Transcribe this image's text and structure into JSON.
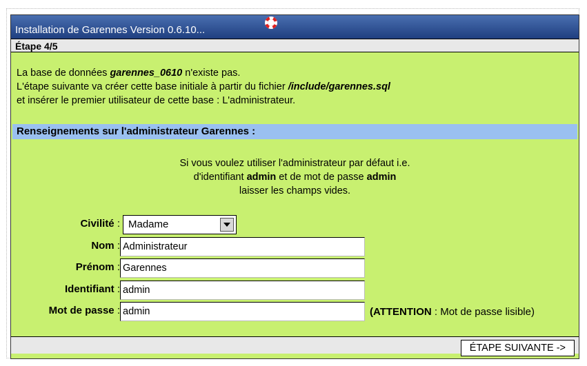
{
  "window": {
    "title": "Installation de Garennes Version 0.6.10...",
    "step": "Étape 4/5"
  },
  "intro": {
    "line1_pre": "La base de données ",
    "db_name": "garennes_0610",
    "line1_post": " n'existe pas.",
    "line2_pre": "L'étape suivante va créer cette base initiale à partir du fichier ",
    "file": "/include/garennes.sql",
    "line3": "et insérer le premier utilisateur de cette base : L'administrateur."
  },
  "section": {
    "title": "Renseignements sur l'administrateur Garennes :"
  },
  "help": {
    "line1": "Si vous voulez utiliser l'administrateur par défaut i.e.",
    "line2_pre": "d'identifiant ",
    "line2_admin1": "admin",
    "line2_mid": " et de mot de passe ",
    "line2_admin2": "admin",
    "line3": "laisser les champs vides."
  },
  "form": {
    "civilite": {
      "label": "Civilité",
      "value": "Madame"
    },
    "nom": {
      "label": "Nom",
      "value": "Administrateur"
    },
    "prenom": {
      "label": "Prénom",
      "value": "Garennes"
    },
    "identifiant": {
      "label": "Identifiant",
      "value": "admin"
    },
    "mdp": {
      "label": "Mot de passe",
      "value": "admin"
    },
    "separator": " : ",
    "warning_bold": "(ATTENTION",
    "warning_rest": " : Mot de passe lisible)"
  },
  "actions": {
    "next_label": "ÉTAPE SUIVANTE ->"
  }
}
